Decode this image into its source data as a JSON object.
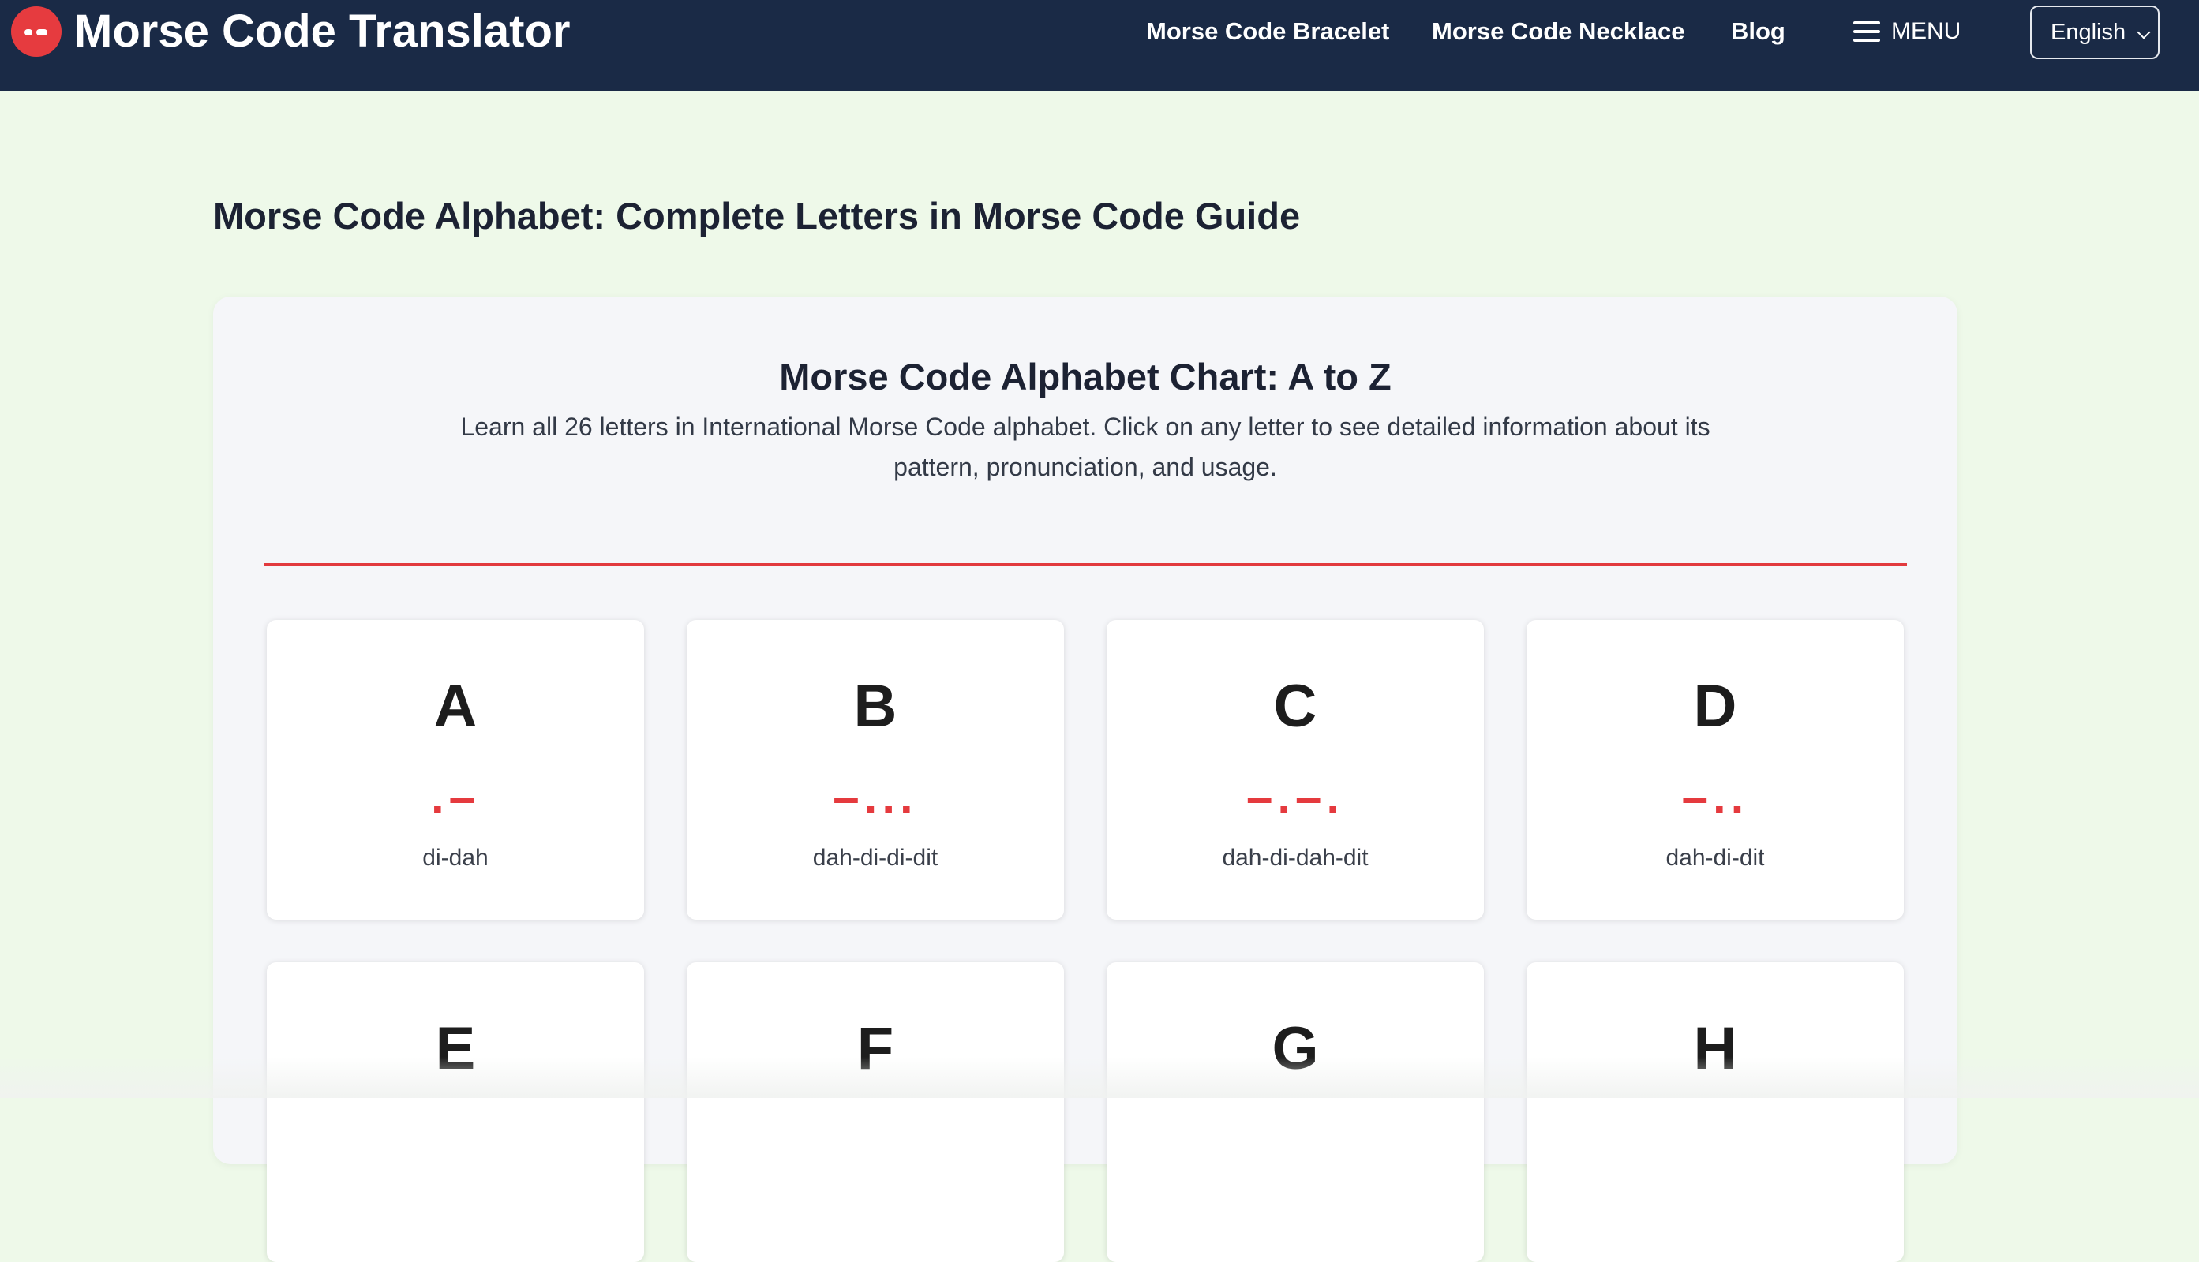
{
  "header": {
    "logo_text": "Morse Code Translator",
    "nav": [
      "Morse Code Bracelet",
      "Morse Code Necklace",
      "Blog"
    ],
    "menu_label": "MENU",
    "language": "English"
  },
  "page_title": "Morse Code Alphabet: Complete Letters in Morse Code Guide",
  "chart": {
    "title": "Morse Code Alphabet Chart: A to Z",
    "description": "Learn all 26 letters in International Morse Code alphabet. Click on any letter to see detailed information about its pattern, pronunciation, and usage."
  },
  "letters": [
    {
      "letter": "A",
      "morse": ".–",
      "pron": "di-dah"
    },
    {
      "letter": "B",
      "morse": "–...",
      "pron": "dah-di-di-dit"
    },
    {
      "letter": "C",
      "morse": "–.–.",
      "pron": "dah-di-dah-dit"
    },
    {
      "letter": "D",
      "morse": "–..",
      "pron": "dah-di-dit"
    },
    {
      "letter": "E",
      "morse": "",
      "pron": ""
    },
    {
      "letter": "F",
      "morse": "",
      "pron": ""
    },
    {
      "letter": "G",
      "morse": "",
      "pron": ""
    },
    {
      "letter": "H",
      "morse": "",
      "pron": ""
    }
  ],
  "colors": {
    "header_bg": "#1a2a46",
    "page_bg": "#eef9e9",
    "accent": "#e53a3e"
  }
}
